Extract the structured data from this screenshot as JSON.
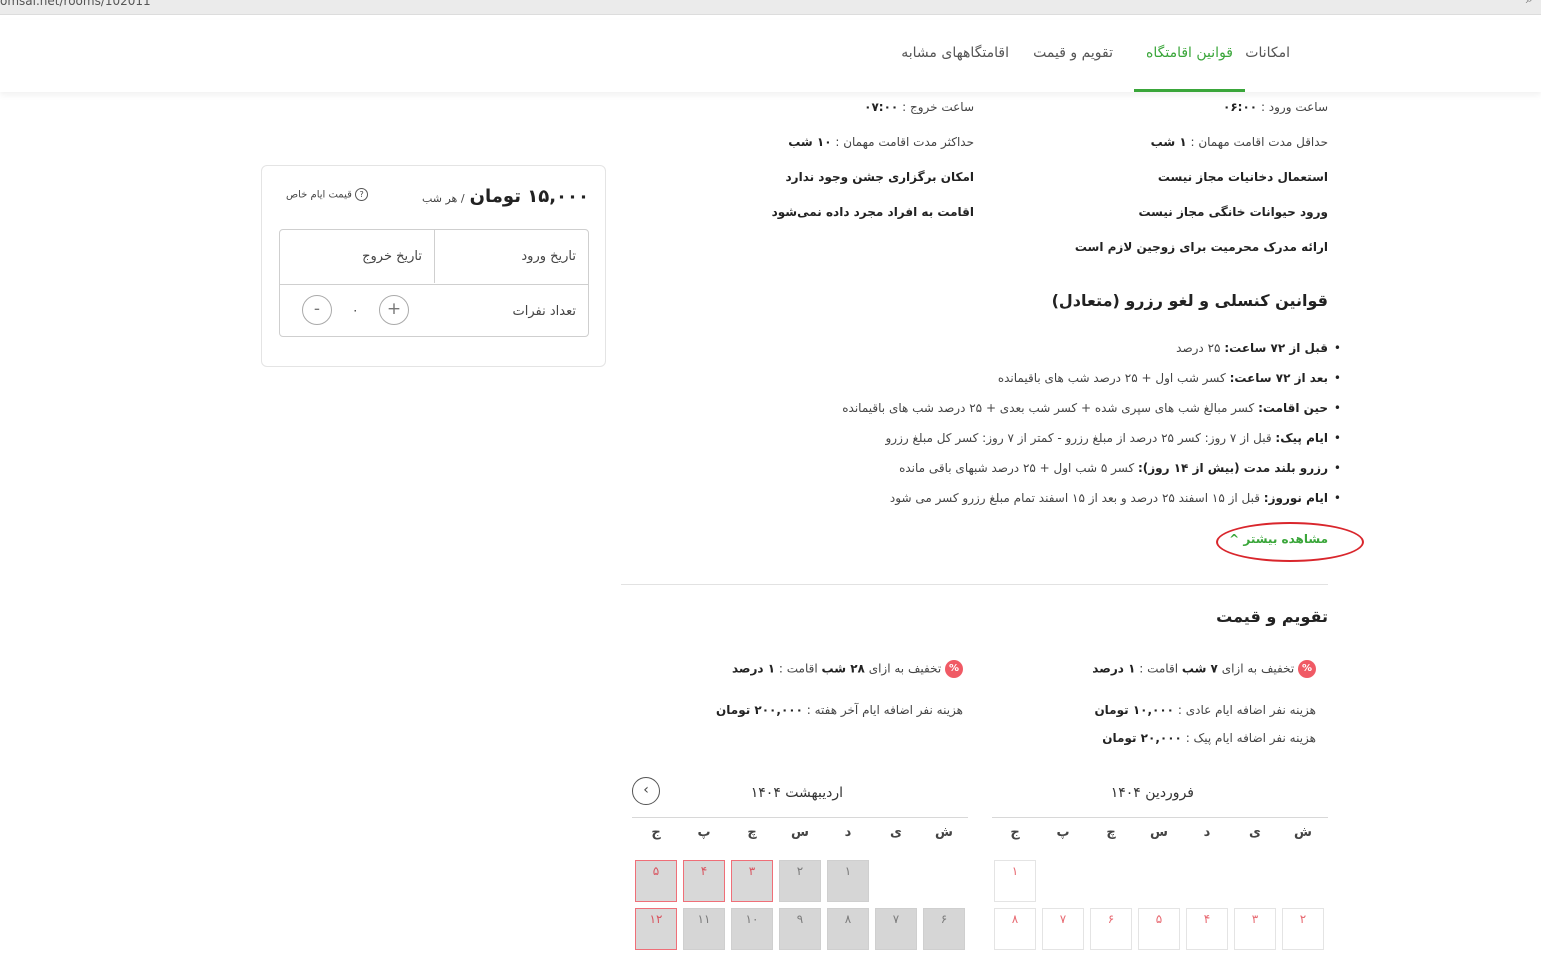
{
  "browser": {
    "url": "omsai.net/rooms/102011"
  },
  "nav": {
    "tabs": [
      "امکانات",
      "قوانین اقامتگاه",
      "تقویم و قیمت",
      "اقامتگاههای مشابه"
    ]
  },
  "rules": {
    "checkin_label": "ساعت ورود :",
    "checkin_value": "۰۶:۰۰",
    "checkout_label": "ساعت خروج :",
    "checkout_value": "۰۷:۰۰",
    "min_stay_label": "حداقل مدت اقامت مهمان :",
    "min_stay_value": "۱ شب",
    "max_stay_label": "حداکثر مدت اقامت مهمان :",
    "max_stay_value": "۱۰ شب",
    "smoking": "استعمال دخانیات مجاز نیست",
    "party": "امکان برگزاری جشن وجود ندارد",
    "pets": "ورود حیوانات خانگی مجاز نیست",
    "singles": "اقامت به افراد مجرد داده نمی‌شود",
    "marriage": "ارائه مدرک محرمیت برای زوجین لازم است"
  },
  "cancellation": {
    "title": "قوانین کنسلی و لغو رزرو (متعادل)",
    "items": [
      {
        "label": "قبل از ۷۲ ساعت:",
        "text": "۲۵ درصد"
      },
      {
        "label": "بعد از ۷۲ ساعت:",
        "text": "کسر شب اول + ۲۵ درصد شب های باقیمانده"
      },
      {
        "label": "حین اقامت:",
        "text": "کسر مبالغ شب های سپری شده + کسر شب بعدی + ۲۵ درصد شب های باقیمانده"
      },
      {
        "label": "ایام پیک:",
        "text": "قبل از ۷ روز: کسر ۲۵ درصد از مبلغ رزرو - کمتر از ۷ روز: کسر کل مبلغ رزرو"
      },
      {
        "label": "رزرو بلند مدت (بیش از ۱۴ روز):",
        "text": "کسر ۵ شب اول + ۲۵ درصد شبهای باقی مانده"
      },
      {
        "label": "ایام نوروز:",
        "text": "قبل از ۱۵ اسفند ۲۵ درصد و بعد از ۱۵ اسفند تمام مبلغ رزرو کسر می شود"
      }
    ],
    "more": "مشاهده بیشتر ^"
  },
  "calendar_section": {
    "title": "تقویم و قیمت",
    "discount1_pre": "تخفیف به ازای",
    "discount1_nights": "۷ شب",
    "discount1_post": "اقامت :",
    "discount1_value": "۱ درصد",
    "discount2_pre": "تخفیف به ازای",
    "discount2_nights": "۲۸ شب",
    "discount2_post": "اقامت :",
    "discount2_value": "۱ درصد",
    "extra_normal_label": "هزینه نفر اضافه ایام عادی :",
    "extra_normal_value": "۱۰,۰۰۰ تومان",
    "extra_peak_label": "هزینه نفر اضافه ایام پیک :",
    "extra_peak_value": "۲۰,۰۰۰ تومان",
    "extra_weekend_label": "هزینه نفر اضافه ایام آخر هفته :",
    "extra_weekend_value": "۲۰۰,۰۰۰ تومان",
    "pct_icon": "%"
  },
  "booking": {
    "price": "۱۵,۰۰۰ تومان",
    "per_night": "/ هر شب",
    "special_price": "قیمت ایام خاص",
    "help_icon": "?",
    "checkin": "تاریخ ورود",
    "checkout": "تاریخ خروج",
    "guests_label": "تعداد نفرات",
    "guests_value": "۰",
    "plus": "+",
    "minus": "-"
  },
  "months": [
    {
      "title": "فروردین ۱۴۰۴",
      "weekdays": [
        "ش",
        "ی",
        "د",
        "س",
        "چ",
        "پ",
        "ج"
      ],
      "days": [
        "۱",
        "۲",
        "۳",
        "۴",
        "۵",
        "۶",
        "۷",
        "۸"
      ]
    },
    {
      "title": "اردیبهشت ۱۴۰۴",
      "weekdays": [
        "ش",
        "ی",
        "د",
        "س",
        "چ",
        "پ",
        "ج"
      ],
      "days": [
        "۱",
        "۲",
        "۳",
        "۴",
        "۵",
        "۶",
        "۷",
        "۸",
        "۹",
        "۱۰",
        "۱۱",
        "۱۲"
      ]
    }
  ],
  "icons": {
    "prev_month": "chevron-left-icon"
  }
}
